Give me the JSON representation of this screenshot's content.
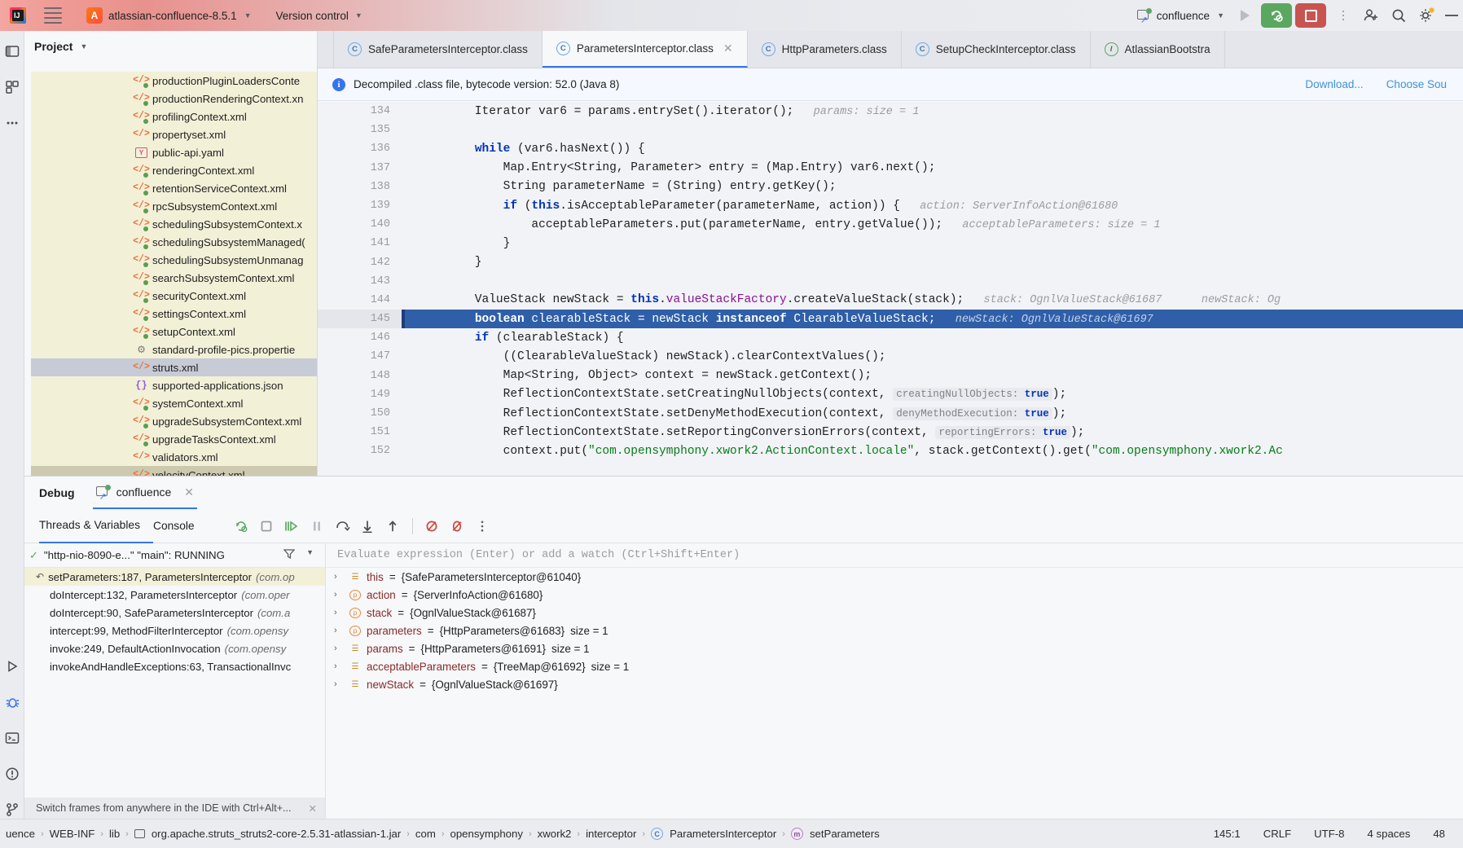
{
  "titlebar": {
    "menu_icon": "hamburger-menu-icon",
    "project_badge": "A",
    "project_name": "atlassian-confluence-8.5.1",
    "vcs_label": "Version control",
    "run_config_name": "confluence",
    "icons": {
      "run": "run-icon",
      "rerun": "rerun-debug-icon",
      "stop": "stop-icon",
      "more": "more-actions-icon",
      "add_user": "add-user-icon",
      "search": "search-icon",
      "settings": "settings-gear-icon",
      "minimize": "minimize-icon"
    }
  },
  "rail": {
    "items": [
      {
        "name": "project-tool-icon",
        "glyph": "▣"
      },
      {
        "name": "commit-tool-icon",
        "glyph": "⊞"
      },
      {
        "name": "more-tool-icon",
        "glyph": "⋯"
      }
    ],
    "bottom_items": [
      {
        "name": "run-tool-icon",
        "glyph": "▷"
      },
      {
        "name": "debug-tool-icon",
        "glyph": "🐞"
      },
      {
        "name": "terminal-tool-icon",
        "glyph": "▧"
      },
      {
        "name": "problems-tool-icon",
        "glyph": "❗"
      },
      {
        "name": "version-control-tool-icon",
        "glyph": "⑂"
      }
    ]
  },
  "project_panel": {
    "title": "Project",
    "tree_items": [
      {
        "label": "productionPluginLoadersConte",
        "icon": "xml-file-icon",
        "selected": false
      },
      {
        "label": "productionRenderingContext.xn",
        "icon": "xml-file-icon",
        "selected": false
      },
      {
        "label": "profilingContext.xml",
        "icon": "xml-file-icon",
        "selected": false
      },
      {
        "label": "propertyset.xml",
        "icon": "xml-plain-file-icon",
        "selected": false
      },
      {
        "label": "public-api.yaml",
        "icon": "yaml-file-icon",
        "selected": false
      },
      {
        "label": "renderingContext.xml",
        "icon": "xml-file-icon",
        "selected": false
      },
      {
        "label": "retentionServiceContext.xml",
        "icon": "xml-file-icon",
        "selected": false
      },
      {
        "label": "rpcSubsystemContext.xml",
        "icon": "xml-file-icon",
        "selected": false
      },
      {
        "label": "schedulingSubsystemContext.x",
        "icon": "xml-file-icon",
        "selected": false
      },
      {
        "label": "schedulingSubsystemManaged(",
        "icon": "xml-file-icon",
        "selected": false
      },
      {
        "label": "schedulingSubsystemUnmanag",
        "icon": "xml-file-icon",
        "selected": false
      },
      {
        "label": "searchSubsystemContext.xml",
        "icon": "xml-file-icon",
        "selected": false
      },
      {
        "label": "securityContext.xml",
        "icon": "xml-file-icon",
        "selected": false
      },
      {
        "label": "settingsContext.xml",
        "icon": "xml-file-icon",
        "selected": false
      },
      {
        "label": "setupContext.xml",
        "icon": "xml-file-icon",
        "selected": false
      },
      {
        "label": "standard-profile-pics.propertie",
        "icon": "properties-file-icon",
        "selected": false
      },
      {
        "label": "struts.xml",
        "icon": "xml-plain-file-icon",
        "selected": true
      },
      {
        "label": "supported-applications.json",
        "icon": "json-file-icon",
        "selected": false
      },
      {
        "label": "systemContext.xml",
        "icon": "xml-file-icon",
        "selected": false
      },
      {
        "label": "upgradeSubsystemContext.xml",
        "icon": "xml-file-icon",
        "selected": false
      },
      {
        "label": "upgradeTasksContext.xml",
        "icon": "xml-file-icon",
        "selected": false
      },
      {
        "label": "validators.xml",
        "icon": "xml-plain-file-icon",
        "selected": false
      },
      {
        "label": "velocityContext.xml",
        "icon": "xml-file-icon",
        "selected": false
      }
    ]
  },
  "editor": {
    "tabs": [
      {
        "label": "SafeParametersInterceptor.class",
        "kind": "class",
        "active": false,
        "closable": false
      },
      {
        "label": "ParametersInterceptor.class",
        "kind": "class",
        "active": true,
        "closable": true
      },
      {
        "label": "HttpParameters.class",
        "kind": "class",
        "active": false,
        "closable": false
      },
      {
        "label": "SetupCheckInterceptor.class",
        "kind": "class",
        "active": false,
        "closable": false
      },
      {
        "label": "AtlassianBootstra",
        "kind": "interface",
        "active": false,
        "closable": false
      }
    ],
    "notification": {
      "text": "Decompiled .class file, bytecode version: 52.0 (Java 8)",
      "link_download": "Download...",
      "link_choose": "Choose Sou"
    },
    "lines": [
      {
        "num": "134",
        "indent": 4,
        "current": false,
        "parts": [
          {
            "t": "Iterator var6 = params.entrySet().iterator();"
          }
        ],
        "hint": "params:  size = 1"
      },
      {
        "num": "135",
        "indent": 0,
        "current": false,
        "parts": [],
        "hint": ""
      },
      {
        "num": "136",
        "indent": 4,
        "current": false,
        "parts": [
          {
            "t": "while",
            "c": "kw"
          },
          {
            "t": " (var6.hasNext()) {"
          }
        ],
        "hint": ""
      },
      {
        "num": "137",
        "indent": 8,
        "current": false,
        "parts": [
          {
            "t": "Map.Entry<String, Parameter> entry = (Map.Entry) var6.next();"
          }
        ],
        "hint": ""
      },
      {
        "num": "138",
        "indent": 8,
        "current": false,
        "parts": [
          {
            "t": "String parameterName = (String) entry.getKey();"
          }
        ],
        "hint": ""
      },
      {
        "num": "139",
        "indent": 8,
        "current": false,
        "parts": [
          {
            "t": "if",
            "c": "kw"
          },
          {
            "t": " ("
          },
          {
            "t": "this",
            "c": "kw"
          },
          {
            "t": ".isAcceptableParameter(parameterName, action)) {"
          }
        ],
        "hint": "action: ServerInfoAction@61680"
      },
      {
        "num": "140",
        "indent": 12,
        "current": false,
        "parts": [
          {
            "t": "acceptableParameters.put(parameterName, entry.getValue());"
          }
        ],
        "hint": "acceptableParameters:  size = 1"
      },
      {
        "num": "141",
        "indent": 8,
        "current": false,
        "parts": [
          {
            "t": "}"
          }
        ],
        "hint": ""
      },
      {
        "num": "142",
        "indent": 4,
        "current": false,
        "parts": [
          {
            "t": "}"
          }
        ],
        "hint": ""
      },
      {
        "num": "143",
        "indent": 0,
        "current": false,
        "parts": [],
        "hint": ""
      },
      {
        "num": "144",
        "indent": 4,
        "current": false,
        "parts": [
          {
            "t": "ValueStack newStack = "
          },
          {
            "t": "this",
            "c": "kw"
          },
          {
            "t": "."
          },
          {
            "t": "valueStackFactory",
            "c": "fld"
          },
          {
            "t": ".createValueStack(stack);"
          }
        ],
        "hint": "stack: OgnlValueStack@61687",
        "hint2": "newStack:  Og"
      },
      {
        "num": "145",
        "indent": 4,
        "current": true,
        "parts": [
          {
            "t": "boolean",
            "c": "kw"
          },
          {
            "t": " clearableStack = newStack "
          },
          {
            "t": "instanceof",
            "c": "kw"
          },
          {
            "t": " ClearableValueStack;"
          }
        ],
        "hint": "newStack: OgnlValueStack@61697"
      },
      {
        "num": "146",
        "indent": 4,
        "current": false,
        "parts": [
          {
            "t": "if",
            "c": "kw"
          },
          {
            "t": " (clearableStack) {"
          }
        ],
        "hint": ""
      },
      {
        "num": "147",
        "indent": 8,
        "current": false,
        "parts": [
          {
            "t": "((ClearableValueStack) newStack).clearContextValues();"
          }
        ],
        "hint": ""
      },
      {
        "num": "148",
        "indent": 8,
        "current": false,
        "parts": [
          {
            "t": "Map<String, Object> context = newStack.getContext();"
          }
        ],
        "hint": ""
      },
      {
        "num": "149",
        "indent": 8,
        "current": false,
        "parts": [
          {
            "t": "ReflectionContextState.setCreatingNullObjects(context, "
          }
        ],
        "badge": "creatingNullObjects:",
        "badgeval": "true",
        "after": ");"
      },
      {
        "num": "150",
        "indent": 8,
        "current": false,
        "parts": [
          {
            "t": "ReflectionContextState.setDenyMethodExecution(context, "
          }
        ],
        "badge": "denyMethodExecution:",
        "badgeval": "true",
        "after": ");"
      },
      {
        "num": "151",
        "indent": 8,
        "current": false,
        "parts": [
          {
            "t": "ReflectionContextState.setReportingConversionErrors(context, "
          }
        ],
        "badge": "reportingErrors:",
        "badgeval": "true",
        "after": ");"
      },
      {
        "num": "152",
        "indent": 8,
        "current": false,
        "parts": [
          {
            "t": "context.put("
          },
          {
            "t": "\"com.opensymphony.xwork2.ActionContext.locale\"",
            "c": "str"
          },
          {
            "t": ", stack.getContext().get("
          },
          {
            "t": "\"com.opensymphony.xwork2.Ac",
            "c": "str"
          }
        ],
        "hint": ""
      }
    ]
  },
  "debug": {
    "tab_label": "Debug",
    "session_tab": "confluence",
    "panel_tabs": [
      {
        "label": "Threads & Variables",
        "active": true
      },
      {
        "label": "Console",
        "active": false
      }
    ],
    "toolbar_icons": [
      {
        "name": "rerun-icon",
        "glyph": "↻"
      },
      {
        "name": "stop-icon",
        "glyph": "■"
      },
      {
        "name": "resume-program-icon",
        "glyph": "▶‖"
      },
      {
        "name": "pause-program-icon",
        "glyph": "‖"
      },
      {
        "name": "step-over-icon",
        "glyph": "⤵"
      },
      {
        "name": "step-into-icon",
        "glyph": "↓"
      },
      {
        "name": "step-out-icon",
        "glyph": "↑"
      },
      {
        "name": "mute-breakpoints-icon",
        "glyph": "⭕"
      },
      {
        "name": "view-breakpoints-icon",
        "glyph": "⌀"
      },
      {
        "name": "more-options-icon",
        "glyph": "⋮"
      }
    ],
    "thread_label": "\"http-nio-8090-e...\" \"main\": RUNNING",
    "frames": [
      {
        "method": "setParameters:187, ParametersInterceptor",
        "pkg": "(com.op",
        "selected": true
      },
      {
        "method": "doIntercept:132, ParametersInterceptor",
        "pkg": "(com.oper",
        "selected": false
      },
      {
        "method": "doIntercept:90, SafeParametersInterceptor",
        "pkg": "(com.a",
        "selected": false
      },
      {
        "method": "intercept:99, MethodFilterInterceptor",
        "pkg": "(com.opensy",
        "selected": false
      },
      {
        "method": "invoke:249, DefaultActionInvocation",
        "pkg": "(com.opensy",
        "selected": false
      },
      {
        "method": "invokeAndHandleExceptions:63, TransactionalInvc",
        "pkg": "",
        "selected": false
      }
    ],
    "frames_hint": "Switch frames from anywhere in the IDE with Ctrl+Alt+...",
    "eval_placeholder": "Evaluate expression (Enter) or add a watch (Ctrl+Shift+Enter)",
    "variables": [
      {
        "icon": "stack-frame-icon",
        "kind": "stack",
        "name": "this",
        "value": "{SafeParametersInterceptor@61040}",
        "size": ""
      },
      {
        "icon": "parameter-icon",
        "kind": "param",
        "name": "action",
        "value": "{ServerInfoAction@61680}",
        "size": ""
      },
      {
        "icon": "parameter-icon",
        "kind": "param",
        "name": "stack",
        "value": "{OgnlValueStack@61687}",
        "size": ""
      },
      {
        "icon": "parameter-icon",
        "kind": "param",
        "name": "parameters",
        "value": "{HttpParameters@61683}",
        "size": "size = 1"
      },
      {
        "icon": "stack-frame-icon",
        "kind": "stack",
        "name": "params",
        "value": "{HttpParameters@61691}",
        "size": "size = 1"
      },
      {
        "icon": "stack-frame-icon",
        "kind": "stack",
        "name": "acceptableParameters",
        "value": "{TreeMap@61692}",
        "size": "size = 1"
      },
      {
        "icon": "stack-frame-icon",
        "kind": "stack",
        "name": "newStack",
        "value": "{OgnlValueStack@61697}",
        "size": ""
      }
    ]
  },
  "statusbar": {
    "breadcrumbs": [
      {
        "label": "uence",
        "icon": ""
      },
      {
        "label": "WEB-INF",
        "icon": ""
      },
      {
        "label": "lib",
        "icon": ""
      },
      {
        "label": "org.apache.struts_struts2-core-2.5.31-atlassian-1.jar",
        "icon": "jar-icon"
      },
      {
        "label": "com",
        "icon": ""
      },
      {
        "label": "opensymphony",
        "icon": ""
      },
      {
        "label": "xwork2",
        "icon": ""
      },
      {
        "label": "interceptor",
        "icon": ""
      },
      {
        "label": "ParametersInterceptor",
        "icon": "class-icon"
      },
      {
        "label": "setParameters",
        "icon": "method-icon"
      }
    ],
    "caret": "145:1",
    "line_sep": "CRLF",
    "encoding": "UTF-8",
    "indent": "4 spaces",
    "extra": "48"
  },
  "colors": {
    "accent_blue": "#3574f0",
    "current_line": "#2f5fa8",
    "tree_bg": "#f3f0d8",
    "green_button": "#5aa75f",
    "red_button": "#c75450"
  }
}
